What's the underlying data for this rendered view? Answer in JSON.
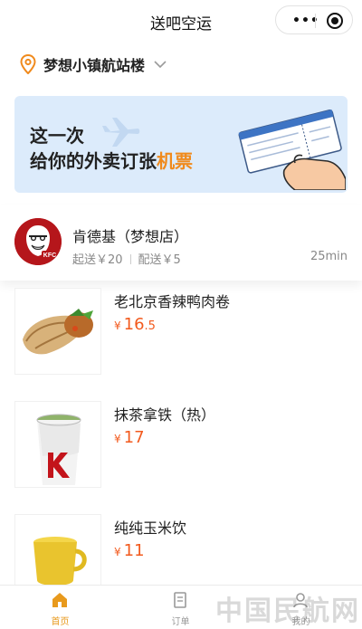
{
  "navbar": {
    "title": "送吧空运",
    "menu_dots": "•••"
  },
  "location": {
    "text": "梦想小镇航站楼"
  },
  "banner": {
    "line1": "这一次",
    "line2_prefix": "给你的外卖订张",
    "line2_highlight": "机票"
  },
  "shop": {
    "name": "肯德基（梦想店）",
    "min_order": "起送￥20",
    "delivery_fee": "配送￥5",
    "delivery_time": "25min"
  },
  "menu": {
    "items": [
      {
        "name": "老北京香辣鸭肉卷",
        "currency": "¥",
        "price_int": "16",
        "price_dec": ".5"
      },
      {
        "name": "抹茶拿铁（热）",
        "currency": "¥",
        "price_int": "17",
        "price_dec": ""
      },
      {
        "name": "纯纯玉米饮",
        "currency": "¥",
        "price_int": "11",
        "price_dec": ""
      }
    ]
  },
  "tabbar": {
    "tabs": [
      {
        "label": "首页",
        "icon": "home-icon",
        "active": true
      },
      {
        "label": "订单",
        "icon": "order-icon",
        "active": false
      },
      {
        "label": "我的",
        "icon": "profile-icon",
        "active": false
      }
    ]
  },
  "watermark": "中国民航网",
  "colors": {
    "accent": "#e89a1d",
    "price": "#f25a1e",
    "kfc_red": "#b5161b",
    "banner_bg": "#dcebfb"
  }
}
